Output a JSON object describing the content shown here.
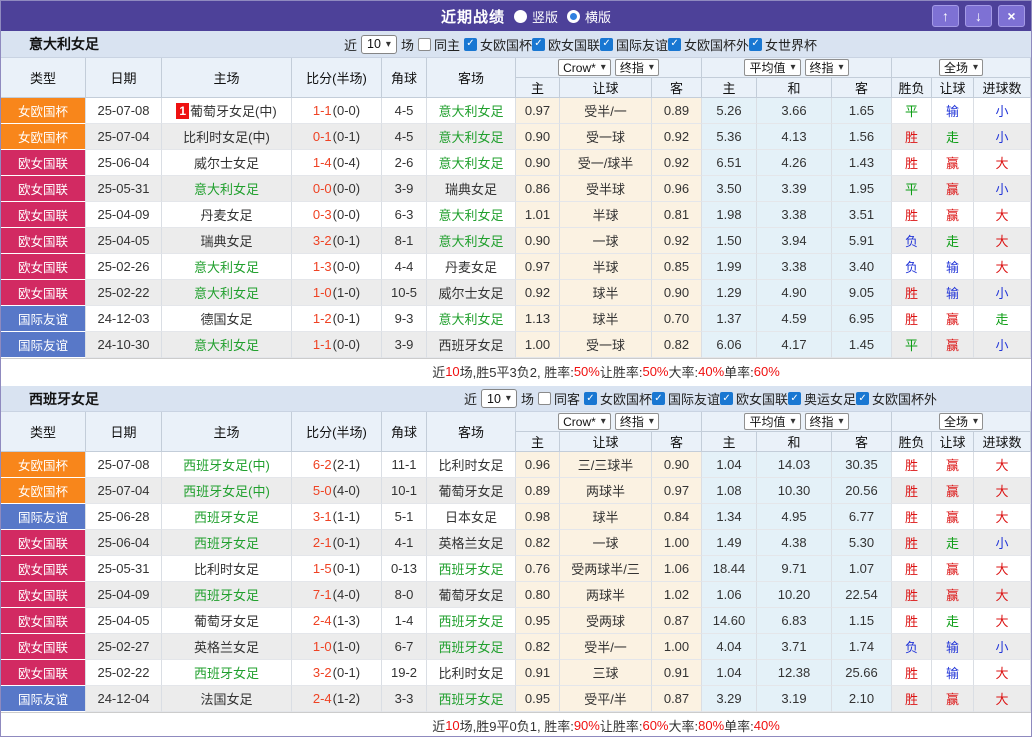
{
  "titlebar": {
    "title": "近期战绩",
    "radio_vertical": "竖版",
    "radio_horizontal": "横版",
    "selected": "横版",
    "buttons": {
      "up": "↑",
      "down": "↓",
      "close": "×"
    }
  },
  "columns": {
    "type": "类型",
    "date": "日期",
    "home": "主场",
    "score": "比分(半场)",
    "corner": "角球",
    "away": "客场",
    "sub": [
      "主",
      "让球",
      "客",
      "主",
      "和",
      "客",
      "胜负",
      "让球",
      "进球数"
    ]
  },
  "header_selects": {
    "bookmaker": "Crow*",
    "book_time": "终指",
    "avg": "平均值",
    "avg_time": "终指",
    "scope": "全场"
  },
  "league_colors": {
    "女欧国杯": "#f8861b",
    "欧女国联": "#d22a62",
    "国际友谊": "#5878c8"
  },
  "result_colors": {
    "胜": "red",
    "平": "green",
    "负": "blue",
    "赢": "red",
    "输": "blue",
    "走": "green",
    "大": "red",
    "小": "blue"
  },
  "check_glyph": "✓",
  "select_arrow": "▾",
  "sections": [
    {
      "team": "意大利女足",
      "filters": {
        "near": "近",
        "count": "10",
        "unit": "场",
        "same": "同主",
        "same_checked": false,
        "leagues": [
          "女欧国杯",
          "欧女国联",
          "国际友谊",
          "女欧国杯外",
          "女世界杯"
        ]
      },
      "rows": [
        {
          "lg": "女欧国杯",
          "date": "25-07-08",
          "rank": "1",
          "home": "葡萄牙女足(中)",
          "hf": false,
          "ft": "1-1",
          "ht": "(0-0)",
          "cn": "4-5",
          "away": "意大利女足",
          "af": true,
          "o1": "0.97",
          "ln": "受半/一",
          "o2": "0.89",
          "a1": "5.26",
          "a2": "3.66",
          "a3": "1.65",
          "r1": "平",
          "r2": "输",
          "r3": "小"
        },
        {
          "lg": "女欧国杯",
          "date": "25-07-04",
          "home": "比利时女足(中)",
          "hf": false,
          "ft": "0-1",
          "ht": "(0-1)",
          "cn": "4-5",
          "away": "意大利女足",
          "af": true,
          "o1": "0.90",
          "ln": "受一球",
          "o2": "0.92",
          "a1": "5.36",
          "a2": "4.13",
          "a3": "1.56",
          "r1": "胜",
          "r2": "走",
          "r3": "小"
        },
        {
          "lg": "欧女国联",
          "date": "25-06-04",
          "home": "威尔士女足",
          "hf": false,
          "ft": "1-4",
          "ht": "(0-4)",
          "cn": "2-6",
          "away": "意大利女足",
          "af": true,
          "o1": "0.90",
          "ln": "受一/球半",
          "o2": "0.92",
          "a1": "6.51",
          "a2": "4.26",
          "a3": "1.43",
          "r1": "胜",
          "r2": "赢",
          "r3": "大"
        },
        {
          "lg": "欧女国联",
          "date": "25-05-31",
          "home": "意大利女足",
          "hf": true,
          "ft": "0-0",
          "ht": "(0-0)",
          "cn": "3-9",
          "away": "瑞典女足",
          "af": false,
          "o1": "0.86",
          "ln": "受半球",
          "o2": "0.96",
          "a1": "3.50",
          "a2": "3.39",
          "a3": "1.95",
          "r1": "平",
          "r2": "赢",
          "r3": "小"
        },
        {
          "lg": "欧女国联",
          "date": "25-04-09",
          "home": "丹麦女足",
          "hf": false,
          "ft": "0-3",
          "ht": "(0-0)",
          "cn": "6-3",
          "away": "意大利女足",
          "af": true,
          "o1": "1.01",
          "ln": "半球",
          "o2": "0.81",
          "a1": "1.98",
          "a2": "3.38",
          "a3": "3.51",
          "r1": "胜",
          "r2": "赢",
          "r3": "大"
        },
        {
          "lg": "欧女国联",
          "date": "25-04-05",
          "home": "瑞典女足",
          "hf": false,
          "ft": "3-2",
          "ht": "(0-1)",
          "cn": "8-1",
          "away": "意大利女足",
          "af": true,
          "o1": "0.90",
          "ln": "一球",
          "o2": "0.92",
          "a1": "1.50",
          "a2": "3.94",
          "a3": "5.91",
          "r1": "负",
          "r2": "走",
          "r3": "大"
        },
        {
          "lg": "欧女国联",
          "date": "25-02-26",
          "home": "意大利女足",
          "hf": true,
          "ft": "1-3",
          "ht": "(0-0)",
          "cn": "4-4",
          "away": "丹麦女足",
          "af": false,
          "o1": "0.97",
          "ln": "半球",
          "o2": "0.85",
          "a1": "1.99",
          "a2": "3.38",
          "a3": "3.40",
          "r1": "负",
          "r2": "输",
          "r3": "大"
        },
        {
          "lg": "欧女国联",
          "date": "25-02-22",
          "home": "意大利女足",
          "hf": true,
          "ft": "1-0",
          "ht": "(1-0)",
          "cn": "10-5",
          "away": "威尔士女足",
          "af": false,
          "o1": "0.92",
          "ln": "球半",
          "o2": "0.90",
          "a1": "1.29",
          "a2": "4.90",
          "a3": "9.05",
          "r1": "胜",
          "r2": "输",
          "r3": "小"
        },
        {
          "lg": "国际友谊",
          "date": "24-12-03",
          "home": "德国女足",
          "hf": false,
          "ft": "1-2",
          "ht": "(0-1)",
          "cn": "9-3",
          "away": "意大利女足",
          "af": true,
          "o1": "1.13",
          "ln": "球半",
          "o2": "0.70",
          "a1": "1.37",
          "a2": "4.59",
          "a3": "6.95",
          "r1": "胜",
          "r2": "赢",
          "r3": "走"
        },
        {
          "lg": "国际友谊",
          "date": "24-10-30",
          "home": "意大利女足",
          "hf": true,
          "ft": "1-1",
          "ht": "(0-0)",
          "cn": "3-9",
          "away": "西班牙女足",
          "af": false,
          "o1": "1.00",
          "ln": "受一球",
          "o2": "0.82",
          "a1": "6.06",
          "a2": "4.17",
          "a3": "1.45",
          "r1": "平",
          "r2": "赢",
          "r3": "小"
        }
      ],
      "summary": [
        {
          "t": "近"
        },
        {
          "t": "10",
          "hl": true
        },
        {
          "t": "场,胜5平3负2, 胜率:"
        },
        {
          "t": "50%",
          "hl": true
        },
        {
          "t": " 让胜率:"
        },
        {
          "t": "50%",
          "hl": true
        },
        {
          "t": " 大率:"
        },
        {
          "t": "40%",
          "hl": true
        },
        {
          "t": " 单率:"
        },
        {
          "t": "60%",
          "hl": true
        }
      ]
    },
    {
      "team": "西班牙女足",
      "filters": {
        "near": "近",
        "count": "10",
        "unit": "场",
        "same": "同客",
        "same_checked": false,
        "leagues": [
          "女欧国杯",
          "国际友谊",
          "欧女国联",
          "奥运女足",
          "女欧国杯外"
        ]
      },
      "rows": [
        {
          "lg": "女欧国杯",
          "date": "25-07-08",
          "home": "西班牙女足(中)",
          "hf": true,
          "ft": "6-2",
          "ht": "(2-1)",
          "cn": "11-1",
          "away": "比利时女足",
          "af": false,
          "o1": "0.96",
          "ln": "三/三球半",
          "o2": "0.90",
          "a1": "1.04",
          "a2": "14.03",
          "a3": "30.35",
          "r1": "胜",
          "r2": "赢",
          "r3": "大"
        },
        {
          "lg": "女欧国杯",
          "date": "25-07-04",
          "home": "西班牙女足(中)",
          "hf": true,
          "ft": "5-0",
          "ht": "(4-0)",
          "cn": "10-1",
          "away": "葡萄牙女足",
          "af": false,
          "o1": "0.89",
          "ln": "两球半",
          "o2": "0.97",
          "a1": "1.08",
          "a2": "10.30",
          "a3": "20.56",
          "r1": "胜",
          "r2": "赢",
          "r3": "大"
        },
        {
          "lg": "国际友谊",
          "date": "25-06-28",
          "home": "西班牙女足",
          "hf": true,
          "ft": "3-1",
          "ht": "(1-1)",
          "cn": "5-1",
          "away": "日本女足",
          "af": false,
          "o1": "0.98",
          "ln": "球半",
          "o2": "0.84",
          "a1": "1.34",
          "a2": "4.95",
          "a3": "6.77",
          "r1": "胜",
          "r2": "赢",
          "r3": "大"
        },
        {
          "lg": "欧女国联",
          "date": "25-06-04",
          "home": "西班牙女足",
          "hf": true,
          "ft": "2-1",
          "ht": "(0-1)",
          "cn": "4-1",
          "away": "英格兰女足",
          "af": false,
          "o1": "0.82",
          "ln": "一球",
          "o2": "1.00",
          "a1": "1.49",
          "a2": "4.38",
          "a3": "5.30",
          "r1": "胜",
          "r2": "走",
          "r3": "小"
        },
        {
          "lg": "欧女国联",
          "date": "25-05-31",
          "home": "比利时女足",
          "hf": false,
          "ft": "1-5",
          "ht": "(0-1)",
          "cn": "0-13",
          "away": "西班牙女足",
          "af": true,
          "o1": "0.76",
          "ln": "受两球半/三",
          "o2": "1.06",
          "a1": "18.44",
          "a2": "9.71",
          "a3": "1.07",
          "r1": "胜",
          "r2": "赢",
          "r3": "大"
        },
        {
          "lg": "欧女国联",
          "date": "25-04-09",
          "home": "西班牙女足",
          "hf": true,
          "ft": "7-1",
          "ht": "(4-0)",
          "cn": "8-0",
          "away": "葡萄牙女足",
          "af": false,
          "o1": "0.80",
          "ln": "两球半",
          "o2": "1.02",
          "a1": "1.06",
          "a2": "10.20",
          "a3": "22.54",
          "r1": "胜",
          "r2": "赢",
          "r3": "大"
        },
        {
          "lg": "欧女国联",
          "date": "25-04-05",
          "home": "葡萄牙女足",
          "hf": false,
          "ft": "2-4",
          "ht": "(1-3)",
          "cn": "1-4",
          "away": "西班牙女足",
          "af": true,
          "o1": "0.95",
          "ln": "受两球",
          "o2": "0.87",
          "a1": "14.60",
          "a2": "6.83",
          "a3": "1.15",
          "r1": "胜",
          "r2": "走",
          "r3": "大"
        },
        {
          "lg": "欧女国联",
          "date": "25-02-27",
          "home": "英格兰女足",
          "hf": false,
          "ft": "1-0",
          "ht": "(1-0)",
          "cn": "6-7",
          "away": "西班牙女足",
          "af": true,
          "o1": "0.82",
          "ln": "受半/一",
          "o2": "1.00",
          "a1": "4.04",
          "a2": "3.71",
          "a3": "1.74",
          "r1": "负",
          "r2": "输",
          "r3": "小"
        },
        {
          "lg": "欧女国联",
          "date": "25-02-22",
          "home": "西班牙女足",
          "hf": true,
          "ft": "3-2",
          "ht": "(0-1)",
          "cn": "19-2",
          "away": "比利时女足",
          "af": false,
          "o1": "0.91",
          "ln": "三球",
          "o2": "0.91",
          "a1": "1.04",
          "a2": "12.38",
          "a3": "25.66",
          "r1": "胜",
          "r2": "输",
          "r3": "大"
        },
        {
          "lg": "国际友谊",
          "date": "24-12-04",
          "home": "法国女足",
          "hf": false,
          "ft": "2-4",
          "ht": "(1-2)",
          "cn": "3-3",
          "away": "西班牙女足",
          "af": true,
          "o1": "0.95",
          "ln": "受平/半",
          "o2": "0.87",
          "a1": "3.29",
          "a2": "3.19",
          "a3": "2.10",
          "r1": "胜",
          "r2": "赢",
          "r3": "大"
        }
      ],
      "summary": [
        {
          "t": "近"
        },
        {
          "t": "10",
          "hl": true
        },
        {
          "t": "场,胜9平0负1, 胜率:"
        },
        {
          "t": "90%",
          "hl": true
        },
        {
          "t": " 让胜率:"
        },
        {
          "t": "60%",
          "hl": true
        },
        {
          "t": " 大率:"
        },
        {
          "t": "80%",
          "hl": true
        },
        {
          "t": " 单率:"
        },
        {
          "t": "40%",
          "hl": true
        }
      ]
    }
  ]
}
